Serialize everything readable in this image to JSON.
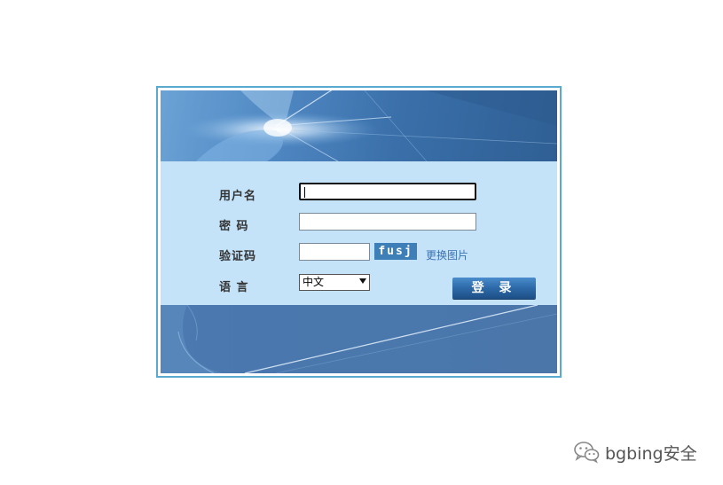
{
  "login": {
    "username_label": "用户名",
    "username_value": "",
    "password_label": "密 码",
    "password_value": "",
    "captcha_label": "验证码",
    "captcha_value": "",
    "captcha_text": "fusj",
    "refresh_captcha_label": "更换图片",
    "language_label": "语 言",
    "language_selected": "中文",
    "submit_label": "登 录"
  },
  "colors": {
    "frame_border": "#5aa9cf",
    "form_background": "#c5e3f8",
    "banner_blue": "#4a78ad",
    "captcha_background": "#3f7fb8",
    "link": "#3b73b5",
    "button": "#2f6cab"
  },
  "watermark": {
    "icon": "wechat-icon",
    "text": "bgbing安全"
  }
}
